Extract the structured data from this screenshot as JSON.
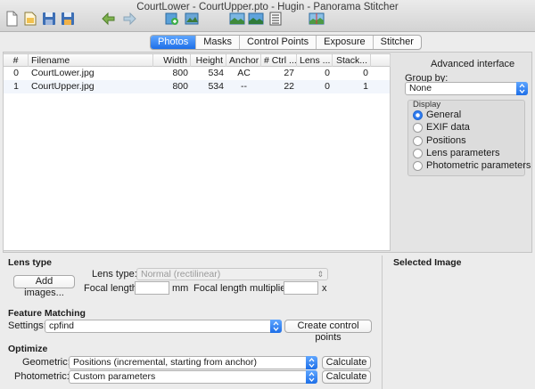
{
  "window": {
    "title": "CourtLower - CourtUpper.pto - Hugin - Panorama Stitcher"
  },
  "toolbar": {
    "buttons": [
      {
        "icon": "new-document-icon"
      },
      {
        "icon": "open-folder-icon"
      },
      {
        "icon": "save-icon"
      },
      {
        "icon": "save-as-icon"
      },
      {
        "icon": "undo-icon"
      },
      {
        "icon": "redo-icon"
      },
      {
        "icon": "add-images-icon"
      },
      {
        "icon": "add-time-series-icon"
      },
      {
        "icon": "preview-icon"
      },
      {
        "icon": "fast-preview-icon"
      },
      {
        "icon": "list-icon"
      },
      {
        "icon": "stitch-icon"
      }
    ]
  },
  "tabs": [
    {
      "label": "Photos",
      "active": true
    },
    {
      "label": "Masks"
    },
    {
      "label": "Control Points"
    },
    {
      "label": "Exposure"
    },
    {
      "label": "Stitcher"
    }
  ],
  "photos_table": {
    "columns": [
      "#",
      "Filename",
      "Width",
      "Height",
      "Anchor",
      "# Ctrl ...",
      "Lens ...",
      "Stack..."
    ],
    "rows": [
      [
        "0",
        "CourtLower.jpg",
        "800",
        "534",
        "AC",
        "27",
        "0",
        "0"
      ],
      [
        "1",
        "CourtUpper.jpg",
        "800",
        "534",
        "--",
        "22",
        "0",
        "1"
      ]
    ]
  },
  "side_panel": {
    "title": "Advanced interface",
    "group_by_label": "Group by:",
    "group_by_value": "None",
    "display_label": "Display",
    "display_options": [
      {
        "label": "General",
        "selected": true
      },
      {
        "label": "EXIF data"
      },
      {
        "label": "Positions"
      },
      {
        "label": "Lens parameters"
      },
      {
        "label": "Photometric parameters"
      }
    ]
  },
  "lens_type": {
    "section": "Lens type",
    "add_images": "Add images...",
    "lens_type_label": "Lens type:",
    "lens_type_value": "Normal (rectilinear)",
    "focal_length_label": "Focal length:",
    "focal_length_unit": "mm",
    "multiplier_label": "Focal length multiplier:",
    "multiplier_unit": "x"
  },
  "selected_image": {
    "section": "Selected Image"
  },
  "feature_matching": {
    "section": "Feature Matching",
    "settings_label": "Settings:",
    "settings_value": "cpfind",
    "create_button": "Create control points"
  },
  "optimize": {
    "section": "Optimize",
    "geometric_label": "Geometric:",
    "geometric_value": "Positions (incremental, starting from anchor)",
    "photometric_label": "Photometric:",
    "photometric_value": "Custom parameters",
    "calculate": "Calculate"
  },
  "colors": {
    "accent": "#2f7cf0",
    "background": "#ececec"
  }
}
